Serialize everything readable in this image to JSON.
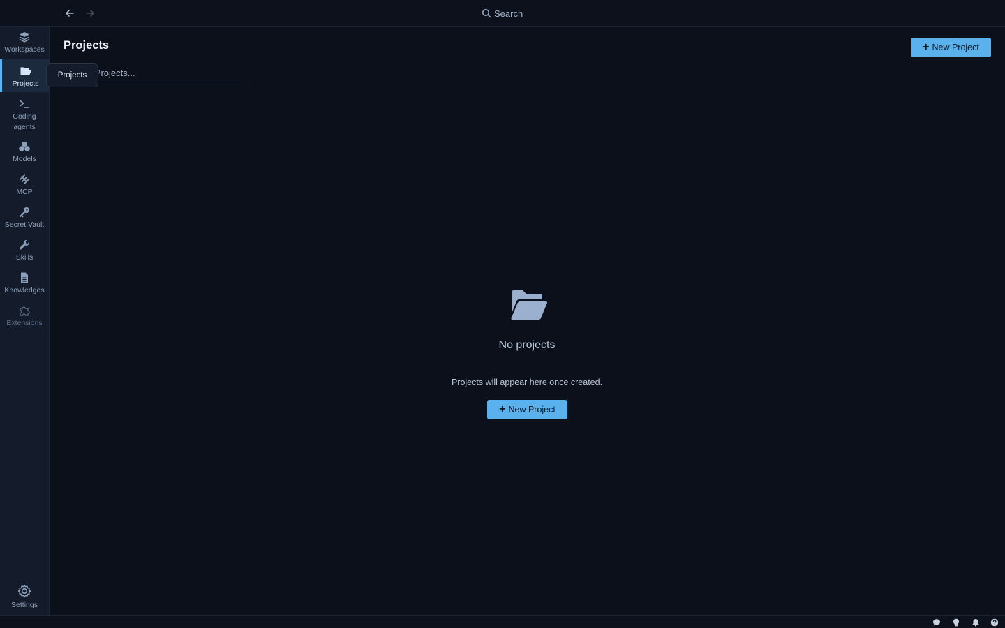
{
  "topbar": {
    "search_label": "Search"
  },
  "sidebar": {
    "items": [
      {
        "label": "Workspaces",
        "icon": "layers-icon"
      },
      {
        "label": "Projects",
        "icon": "folder-open-icon"
      },
      {
        "label": "Coding agents",
        "icon": "terminal-icon"
      },
      {
        "label": "Models",
        "icon": "cubes-icon"
      },
      {
        "label": "MCP",
        "icon": "mcp-icon"
      },
      {
        "label": "Secret Vault",
        "icon": "key-icon"
      },
      {
        "label": "Skills",
        "icon": "wrench-icon"
      },
      {
        "label": "Knowledges",
        "icon": "document-icon"
      },
      {
        "label": "Extensions",
        "icon": "puzzle-icon"
      }
    ],
    "settings_label": "Settings",
    "active_tooltip": "Projects"
  },
  "main": {
    "title": "Projects",
    "search_placeholder": "Search Projects...",
    "new_project_label": "New Project",
    "empty": {
      "title": "No projects",
      "description": "Projects will appear here once created.",
      "button_label": "New Project"
    }
  },
  "colors": {
    "accent": "#5ab1ec",
    "background": "#0b101a",
    "sidebar": "#141c2b"
  }
}
